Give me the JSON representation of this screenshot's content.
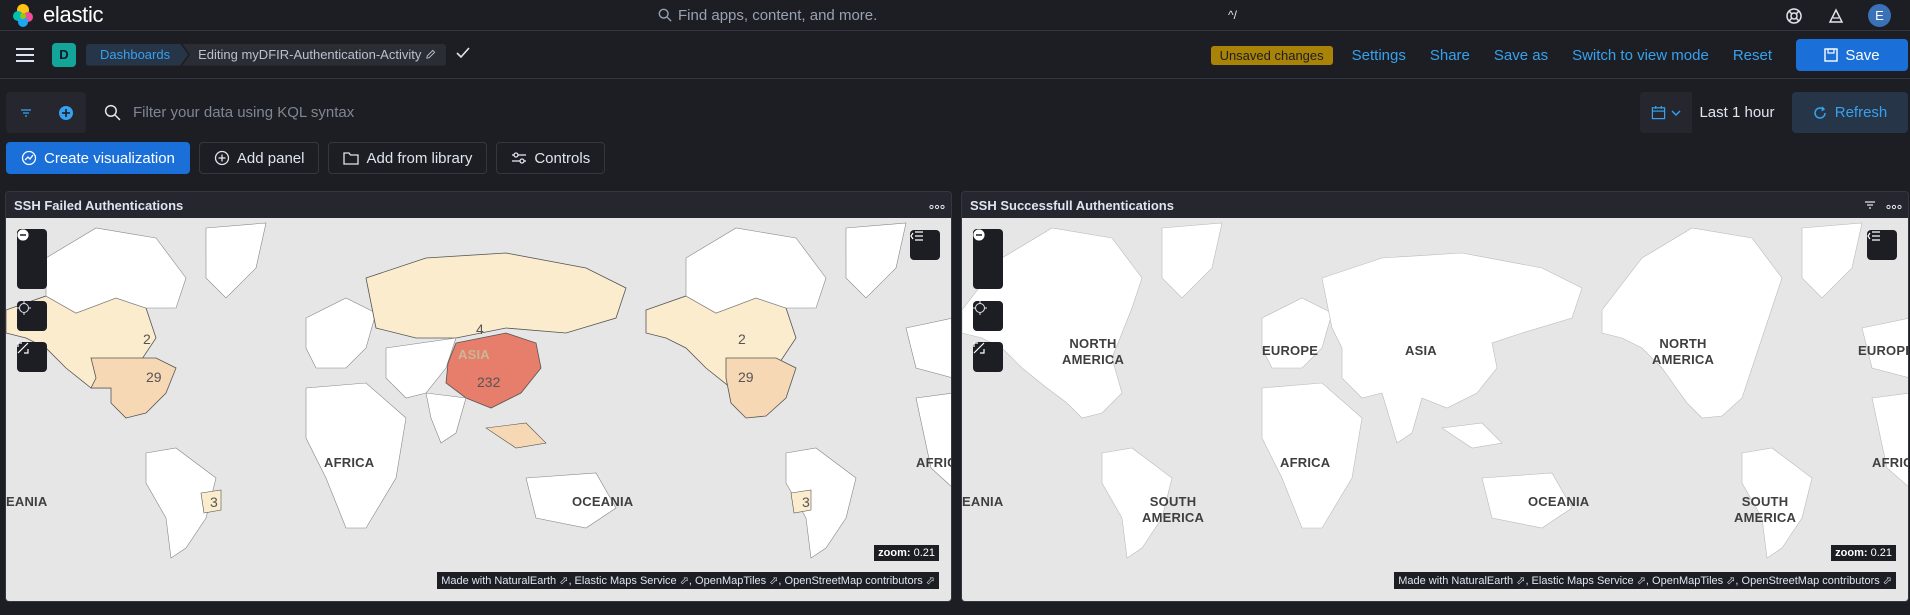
{
  "header": {
    "brand": "elastic",
    "search_placeholder": "Find apps, content, and more.",
    "search_shortcut": "^/",
    "avatar_initial": "E"
  },
  "breadcrumb": {
    "space_initial": "D",
    "root": "Dashboards",
    "current": "Editing myDFIR-Authentication-Activity"
  },
  "top_actions": {
    "unsaved": "Unsaved changes",
    "settings": "Settings",
    "share": "Share",
    "save_as": "Save as",
    "switch_view": "Switch to view mode",
    "reset": "Reset",
    "save": "Save"
  },
  "query": {
    "placeholder": "Filter your data using KQL syntax",
    "time_range": "Last 1 hour",
    "refresh": "Refresh"
  },
  "toolbar": {
    "create_visualization": "Create visualization",
    "add_panel": "Add panel",
    "add_from_library": "Add from library",
    "controls": "Controls"
  },
  "panels": [
    {
      "title": "SSH Failed Authentications",
      "zoom_label": "zoom:",
      "zoom_value": "0.21",
      "attribution": "Made with NaturalEarth ⬀, Elastic Maps Service ⬀, OpenMapTiles ⬀, OpenStreetMap contributors ⬀",
      "region_labels": [
        "AFRICA",
        "OCEANIA",
        "EANIA",
        "AFRIC",
        "ASIA"
      ],
      "counts": [
        "2",
        "29",
        "4",
        "232",
        "2",
        "29",
        "3",
        "3"
      ]
    },
    {
      "title": "SSH Successfull Authentications",
      "zoom_label": "zoom:",
      "zoom_value": "0.21",
      "attribution": "Made with NaturalEarth ⬀, Elastic Maps Service ⬀, OpenMapTiles ⬀, OpenStreetMap contributors ⬀",
      "region_labels": [
        "NORTH\nAMERICA",
        "EUROPE",
        "ASIA",
        "NORTH\nAMERICA",
        "EUROPE",
        "AFRICA",
        "AFRIC",
        "EANIA",
        "OCEANIA",
        "SOUTH\nAMERICA",
        "SOUTH\nAMERICA"
      ]
    }
  ],
  "colors": {
    "accent": "#1a6fd9",
    "link": "#36a2ef",
    "warning": "#a98208",
    "choropleth_low": "#fbeccd",
    "choropleth_mid": "#f6d8b5",
    "choropleth_high": "#e77d6b"
  }
}
